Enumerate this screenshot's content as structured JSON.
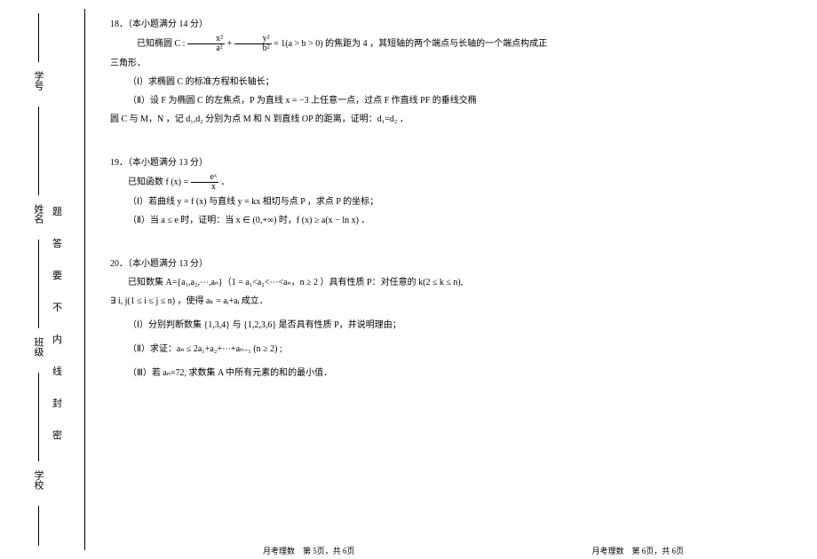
{
  "binding": {
    "label_school": "学校",
    "label_class": "班级",
    "label_name": "姓名",
    "label_number": "学号",
    "seal_line": "密 封 线 内 不 要 答 题"
  },
  "q18": {
    "header": "18．（本小题满分 14 分）",
    "intro_prefix": "已知椭圆 C :",
    "frac1_num": "x²",
    "frac1_den": "a²",
    "plus": " + ",
    "frac2_num": "y²",
    "frac2_den": "b²",
    "intro_suffix": " = 1(a > b > 0) 的焦距为 4 ，其短轴的两个端点与长轴的一个端点构成正",
    "triangle": "三角形．",
    "part1": "（Ⅰ）求椭圆 C 的标准方程和长轴长；",
    "part2": "（Ⅱ）设 F 为椭圆 C 的左焦点，P 为直线 x = −3 上任意一点，过点 F 作直线 PF 的垂线交椭",
    "part2b": "圆 C 与 M，N ，记 d₁,d₂ 分别为点 M 和 N 到直线 OP 的距离，证明：d₁=d₂ ．"
  },
  "q19": {
    "header": "19．（本小题满分 13 分）",
    "intro_prefix": "已知函数 f (x) = ",
    "frac_num": "eˣ",
    "frac_den": "x",
    "intro_suffix": " ．",
    "part1": "（Ⅰ）若曲线 y = f (x) 与直线 y = kx 相切与点 P ，求点 P 的坐标；",
    "part2": "（Ⅱ）当 a ≤ e 时，证明：当 x ∈ (0,+∞) 时，f (x) ≥ a(x − ln x) ．"
  },
  "q20": {
    "header": "20．（本小题满分 13 分）",
    "intro": "已知数集 A={a₁,a₂,⋯,aₙ}（1 = a₁<a₂<⋯<aₙ，n ≥ 2 ）具有性质 P：对任意的 k(2 ≤ k ≤ n),",
    "intro2": "∃ i, j(1 ≤ i ≤ j ≤ n) ，使得 aₖ = aᵢ+aⱼ 成立．",
    "part1": "（Ⅰ）分别判断数集 {1,3,4} 与 {1,2,3,6} 是否具有性质 P，并说明理由；",
    "part2": "（Ⅱ）求证：aₙ ≤ 2a₁+a₂+⋯+aₙ₋₁ (n ≥ 2) ;",
    "part3": "（Ⅲ）若 aₙ=72, 求数集 A 中所有元素的和的最小值．"
  },
  "footer": {
    "left": "月考理数　第 5页，共 6页",
    "right": "月考理数　第 6页，共 6页"
  }
}
